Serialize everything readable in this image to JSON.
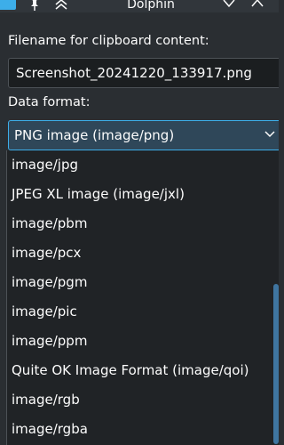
{
  "window": {
    "title": "Dolphin",
    "accent": "#3daee9"
  },
  "titlebar": {
    "icons": [
      "app-icon",
      "pin-icon",
      "keep-above-icon",
      "minimize-icon",
      "maximize-icon"
    ]
  },
  "form": {
    "filename_label": "Filename for clipboard content:",
    "filename_value": "Screenshot_20241220_133917.png",
    "format_label": "Data format:",
    "format_selected": "PNG image (image/png)"
  },
  "format_options": [
    "image/jpg",
    "JPEG XL image (image/jxl)",
    "image/pbm",
    "image/pcx",
    "image/pgm",
    "image/pic",
    "image/ppm",
    "Quite OK Image Format (image/qoi)",
    "image/rgb",
    "image/rgba"
  ]
}
